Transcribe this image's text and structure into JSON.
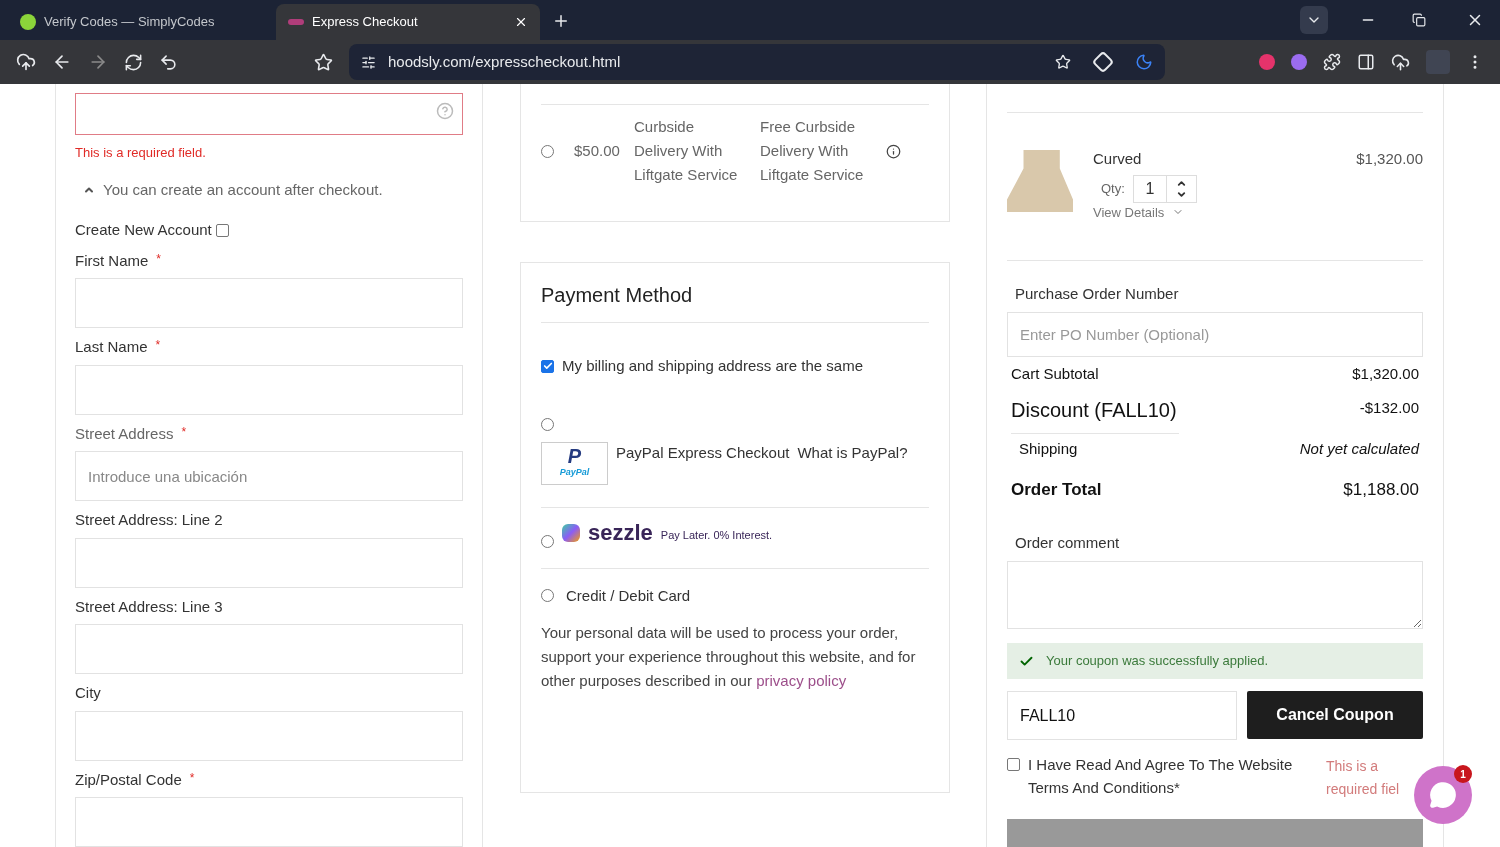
{
  "browser": {
    "tabs": [
      {
        "title": "Verify Codes — SimplyCodes",
        "selected": false
      },
      {
        "title": "Express Checkout",
        "selected": true
      }
    ],
    "url": "hoodsly.com/expresscheckout.html"
  },
  "left": {
    "error_input": {
      "invalid": true
    },
    "error_text": "This is a required field.",
    "account_note": "You can create an account after checkout.",
    "create_account": {
      "label": "Create New Account",
      "checked": false
    },
    "fields": [
      {
        "label": "First Name",
        "required_mark": "*"
      },
      {
        "label": "Last Name",
        "required_mark": "*"
      },
      {
        "label": "Street Address",
        "required_mark": "*",
        "placeholder": "Introduce una ubicación"
      },
      {
        "label": "Street Address: Line 2"
      },
      {
        "label": "Street Address: Line 3"
      },
      {
        "label": "City"
      },
      {
        "label": "Zip/Postal Code",
        "required_mark": "*"
      }
    ]
  },
  "shipping_option": {
    "price": "$50.00",
    "method": "Curbside Delivery With Liftgate Service",
    "carrier": "Free Curbside Delivery With Liftgate Service",
    "selected": false
  },
  "payment": {
    "title": "Payment Method",
    "same_address": {
      "label": "My billing and shipping address are the same",
      "checked": true
    },
    "methods": [
      {
        "kind": "paypal",
        "label": "PayPal Express Checkout",
        "link": "What is PayPal?",
        "logo_mark": "P",
        "logo_text": "PayPal",
        "selected": false
      },
      {
        "kind": "sezzle",
        "brand": "sezzle",
        "tagline": "Pay Later. 0% Interest.",
        "selected": false
      },
      {
        "kind": "card",
        "label": "Credit / Debit Card",
        "selected": false
      }
    ],
    "privacy_text": "Your personal data will be used to process your order, support your experience throughout this website, and for other purposes described in our",
    "privacy_link": "privacy policy"
  },
  "summary": {
    "item": {
      "name": "Curved",
      "price": "$1,320.00",
      "qty_label": "Qty:",
      "qty": "1",
      "view_details": "View Details"
    },
    "po": {
      "label": "Purchase Order Number",
      "placeholder": "Enter PO Number (Optional)"
    },
    "totals": [
      {
        "kind": "subtotal",
        "label": "Cart Subtotal",
        "value": "$1,320.00"
      },
      {
        "kind": "discount",
        "label": "Discount (FALL10)",
        "value": "-$132.00"
      },
      {
        "kind": "shipping",
        "label": "Shipping",
        "value": "Not yet calculated"
      },
      {
        "kind": "total",
        "label": "Order Total",
        "value": "$1,188.00"
      }
    ],
    "comment_label": "Order comment",
    "coupon": {
      "message": "Your coupon was successfully applied.",
      "code": "FALL10",
      "button": "Cancel Coupon"
    },
    "terms": {
      "label": "I Have Read And Agree To The Website Terms And Conditions*",
      "checked": false,
      "error": "This is a required fiel"
    }
  },
  "chat": {
    "badge": "1"
  }
}
